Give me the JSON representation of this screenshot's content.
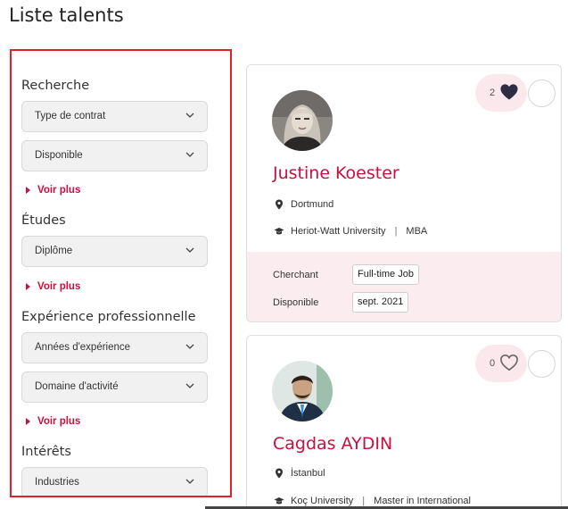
{
  "page": {
    "title": "Liste talents"
  },
  "sidebar": {
    "sections": [
      {
        "title": "Recherche",
        "selects": [
          "Type de contrat",
          "Disponible"
        ],
        "more": "Voir plus"
      },
      {
        "title": "Études",
        "selects": [
          "Diplôme"
        ],
        "more": "Voir plus"
      },
      {
        "title": "Expérience professionnelle",
        "selects": [
          "Années d'expérience",
          "Domaine d'activité"
        ],
        "more": "Voir plus"
      },
      {
        "title": "Intérêts",
        "selects": [
          "Industries"
        ]
      }
    ]
  },
  "talents": [
    {
      "name": "Justine Koester",
      "location": "Dortmund",
      "school": "Heriot-Watt University",
      "degree": "MBA",
      "likes": "2",
      "liked": true,
      "seeking_label": "Cherchant",
      "seeking_value": "Full-time Job",
      "available_label": "Disponible",
      "available_value": "sept. 2021"
    },
    {
      "name": "Cagdas AYDIN",
      "location": "İstanbul",
      "school": "Koç University",
      "degree": "Master in International",
      "likes": "0",
      "liked": false
    }
  ],
  "colors": {
    "accent": "#c8103e",
    "highlight_border": "#e0212c",
    "card_footer": "#fbecef",
    "heart_filled": "#2d2d44"
  },
  "icons": {
    "chevron": "chevron-down-icon",
    "location": "location-pin-icon",
    "education": "graduation-cap-icon",
    "like": "heart-icon",
    "more": "caret-right-icon"
  }
}
